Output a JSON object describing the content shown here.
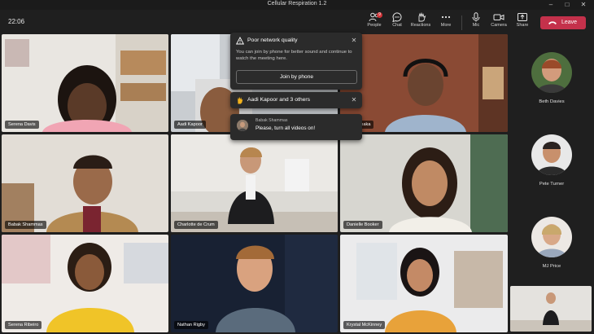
{
  "window": {
    "title": "Cellular Respiration 1.2"
  },
  "toolbar": {
    "clock": "22:06",
    "people": {
      "label": "People",
      "badge": "9"
    },
    "chat": {
      "label": "Chat"
    },
    "reactions": {
      "label": "Reactions"
    },
    "more": {
      "label": "More"
    },
    "mic": {
      "label": "Mic"
    },
    "camera": {
      "label": "Camera"
    },
    "share": {
      "label": "Share"
    },
    "leave": {
      "label": "Leave"
    }
  },
  "participants": [
    {
      "name": "Serena Davis"
    },
    {
      "name": "Aadi Kapoor"
    },
    {
      "name": "Ray Tanaka"
    },
    {
      "name": "Babak Shammas"
    },
    {
      "name": "Charlotte de Crum"
    },
    {
      "name": "Danielle Booker"
    },
    {
      "name": "Serena Ribeiro"
    },
    {
      "name": "Nathan Rigby"
    },
    {
      "name": "Krystal McKinney"
    }
  ],
  "rail": [
    {
      "name": "Beth Davies"
    },
    {
      "name": "Pete Turner"
    },
    {
      "name": "MJ Price"
    }
  ],
  "notifications": {
    "network": {
      "title": "Poor network quality",
      "body": "You can join by phone for better sound and continue to watch the meeting here.",
      "button": "Join by phone"
    },
    "raised_hands": {
      "text": "Aadi Kapoor and 3 others"
    },
    "chat": {
      "sender": "Babak Shammas",
      "message": "Please, turn all videos on!"
    }
  },
  "colors": {
    "leave": "#c4314b",
    "active_outline": "#8c8ee6",
    "hand": "#f2b21c",
    "badge": "#d13438"
  }
}
